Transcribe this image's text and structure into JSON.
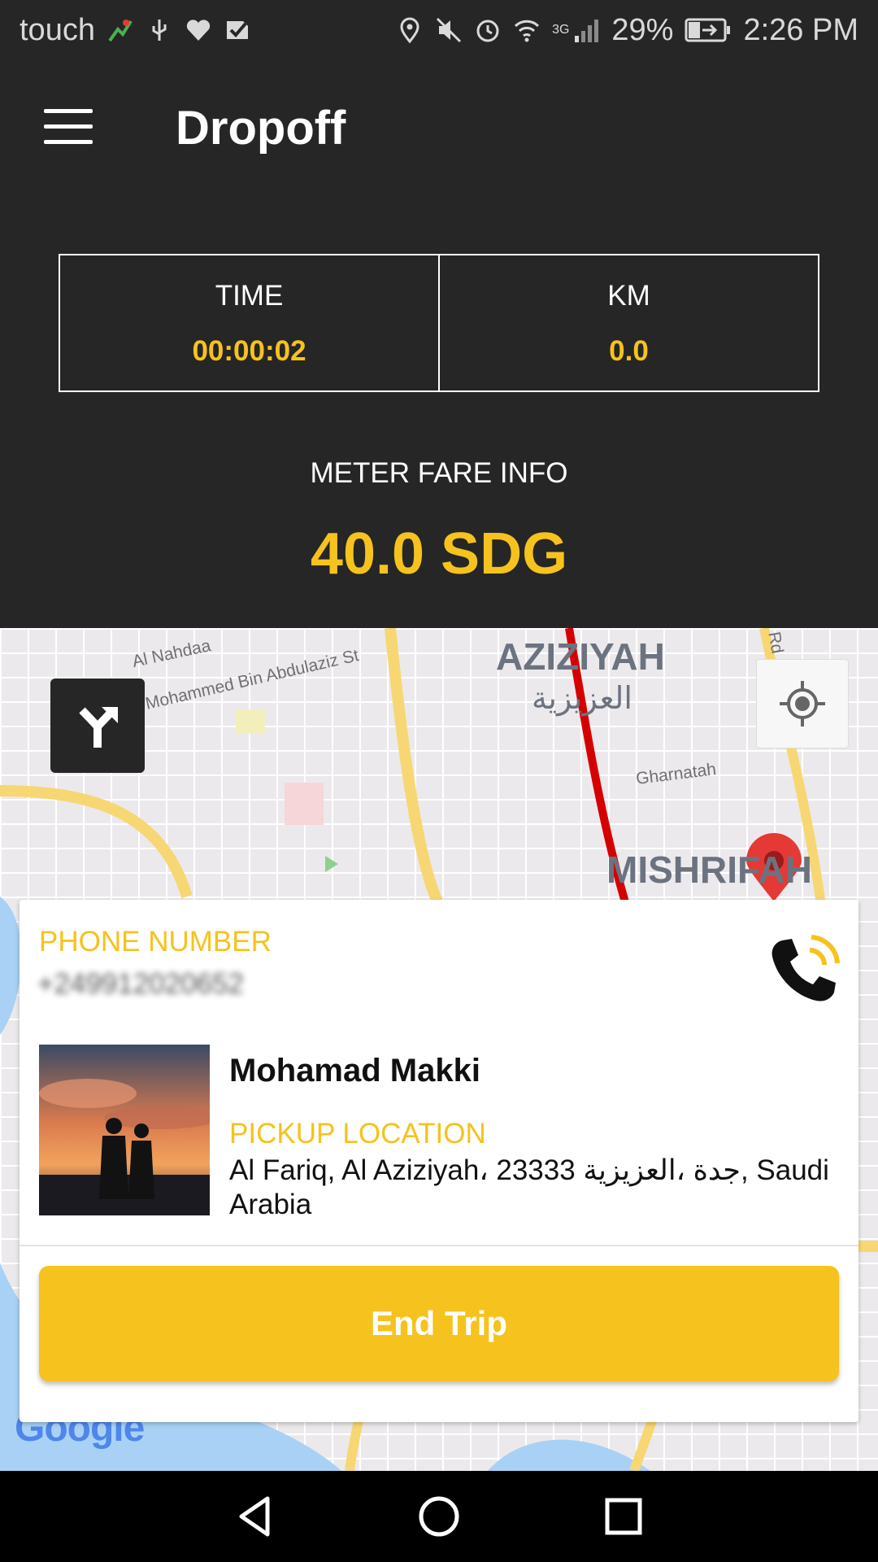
{
  "status_bar": {
    "carrier": "touch",
    "battery": "29%",
    "time": "2:26 PM",
    "network_label": "3G",
    "icons_left": [
      "signal-app-icon",
      "usb-icon",
      "health-icon",
      "check-icon"
    ],
    "icons_right": [
      "location-icon",
      "mute-icon",
      "alarm-icon",
      "wifi-icon",
      "cell-signal-icon",
      "battery-icon"
    ]
  },
  "app_bar": {
    "title": "Dropoff",
    "menu_icon": "hamburger-menu-icon"
  },
  "stats": {
    "time_label": "TIME",
    "time_value": "00:00:02",
    "km_label": "KM",
    "km_value": "0.0"
  },
  "fare": {
    "label": "METER FARE INFO",
    "value": "40.0 SDG"
  },
  "map": {
    "districts": [
      "AZIZIYAH",
      "العزيزية",
      "MISHRIFAH"
    ],
    "streets": [
      "Al Nahdaa",
      "Mohammed Bin Abdulaziz St",
      "Gharnatah",
      "Rd"
    ],
    "attribution": "Google",
    "colors": {
      "background": "#ece9ec",
      "major_road": "#f7d774",
      "traffic_red": "#d50000",
      "water": "#a8d1f5"
    }
  },
  "card": {
    "phone_label": "PHONE NUMBER",
    "phone_value": "+249912020652",
    "rider_name": "Mohamad Makki",
    "pickup_label": "PICKUP LOCATION",
    "pickup_address": "Al Fariq, Al Aziziyah، 23333 جدة ،العزيزية, Saudi Arabia",
    "end_trip_label": "End Trip"
  },
  "nav_bar": {
    "icons": [
      "back-icon",
      "home-icon",
      "recents-icon"
    ]
  },
  "theme": {
    "accent": "#f6c21d",
    "dark": "#262626"
  }
}
